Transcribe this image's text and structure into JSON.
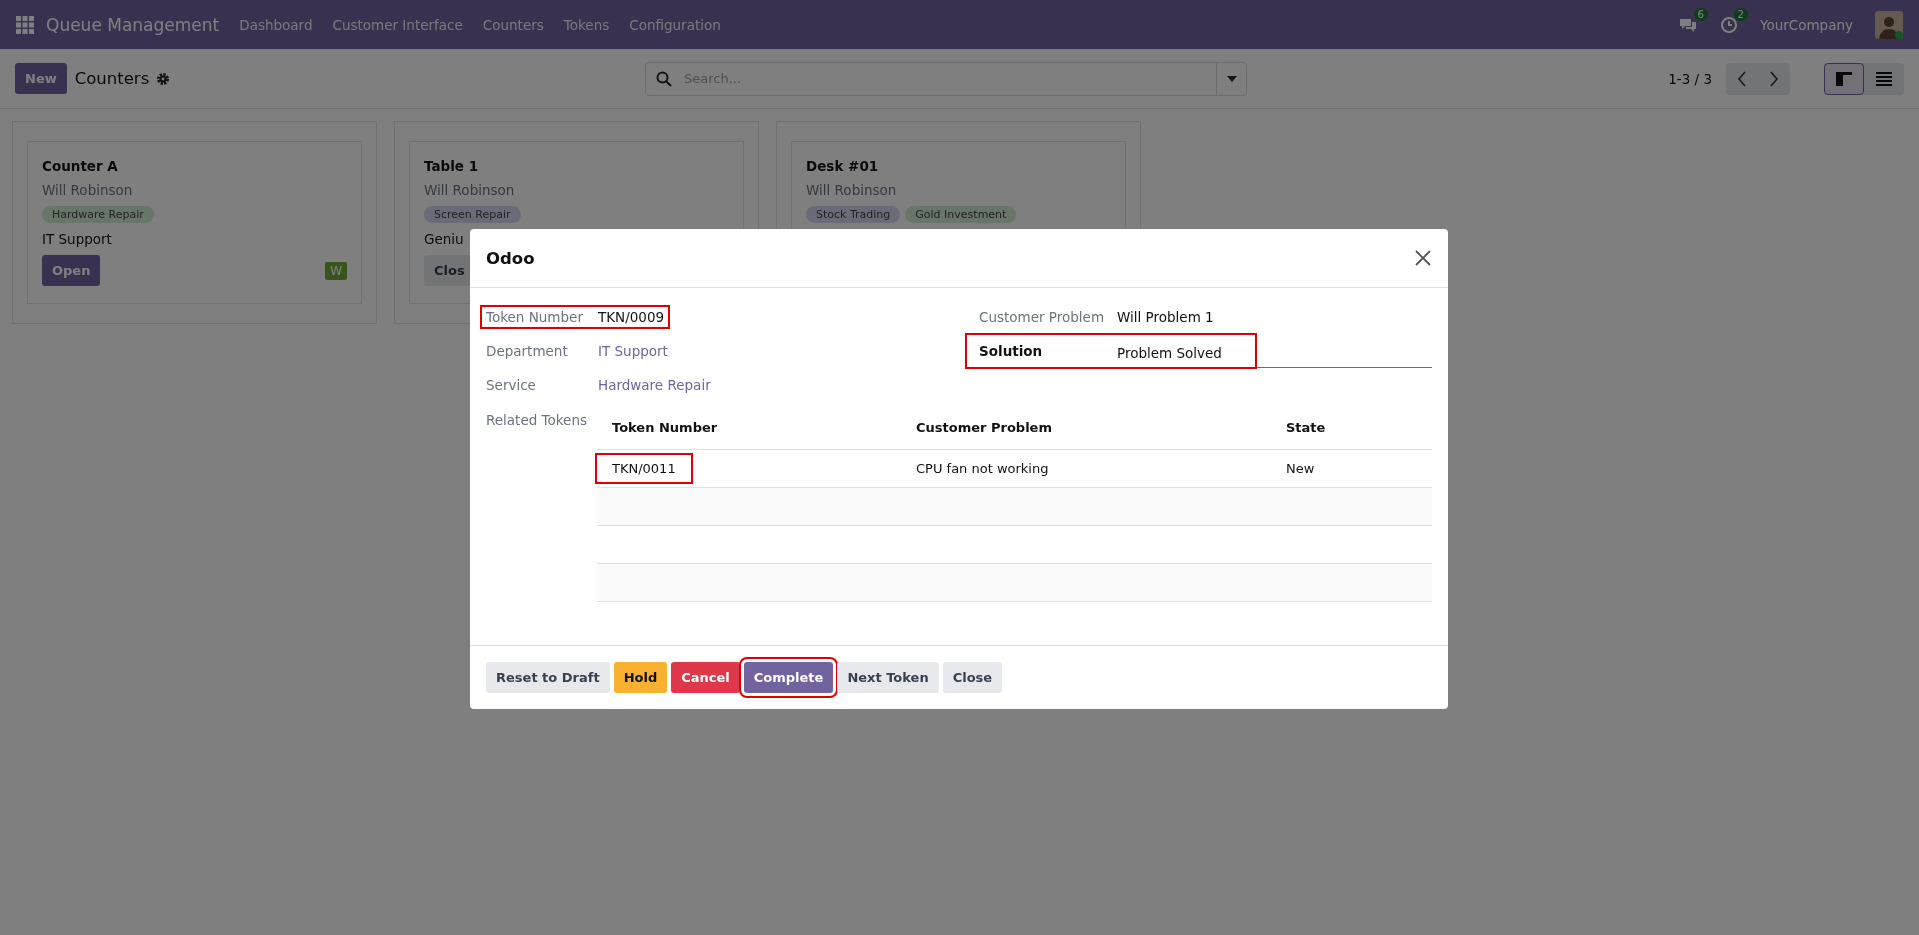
{
  "navbar": {
    "app_name": "Queue Management",
    "menu": [
      "Dashboard",
      "Customer Interface",
      "Counters",
      "Tokens",
      "Configuration"
    ],
    "messages_count": "6",
    "activities_count": "2",
    "company": "YourCompany"
  },
  "control_panel": {
    "new_button": "New",
    "title": "Counters",
    "search": {
      "placeholder": "Search..."
    },
    "pager": "1-3 / 3",
    "views": [
      {
        "kind": "kanban",
        "selected": true
      },
      {
        "kind": "list",
        "selected": false
      }
    ]
  },
  "cards": [
    {
      "name": "Counter A",
      "user": "Will Robinson",
      "tags": [
        {
          "label": "Hardware Repair",
          "color": "#687669"
        }
      ],
      "department": "IT Support",
      "button": {
        "label": "Open",
        "kind": "primary"
      },
      "badge": "W"
    },
    {
      "name": "Table 1",
      "user": "Will Robinson",
      "tags": [
        {
          "label": "Screen Repair",
          "color": "#696b79"
        }
      ],
      "department": "Geniu",
      "button": {
        "label": "Clos",
        "kind": "secondary"
      }
    },
    {
      "name": "Desk #01",
      "user": "Will Robinson",
      "tags": [
        {
          "label": "Stock Trading",
          "color": "#696b79"
        },
        {
          "label": "Gold Investment",
          "color": "#687669"
        }
      ]
    }
  ],
  "dialog": {
    "title": "Odoo",
    "left_fields": [
      {
        "label": "Token Number",
        "value": "TKN/0009",
        "kind": "text",
        "highlighted": true
      },
      {
        "label": "Department",
        "value": "IT Support",
        "kind": "link",
        "highlighted": false
      },
      {
        "label": "Service",
        "value": "Hardware Repair",
        "kind": "link",
        "highlighted": false
      }
    ],
    "right_fields": [
      {
        "label": "Customer Problem",
        "value": "Will Problem 1",
        "kind": "text",
        "highlighted": false
      },
      {
        "label": "Solution",
        "value": "Problem Solved",
        "kind": "input",
        "highlighted": true
      }
    ],
    "related_tokens": {
      "label": "Related Tokens",
      "columns": [
        "Token Number",
        "Customer Problem",
        "State"
      ],
      "rows": [
        {
          "cells": [
            "TKN/0011",
            "CPU fan not working",
            "New"
          ],
          "highlighted": true
        }
      ]
    },
    "buttons": [
      {
        "label": "Reset to Draft",
        "kind": "secondary",
        "highlighted": false
      },
      {
        "label": "Hold",
        "kind": "warning",
        "highlighted": false
      },
      {
        "label": "Cancel",
        "kind": "danger",
        "highlighted": false
      },
      {
        "label": "Complete",
        "kind": "primary",
        "highlighted": true
      },
      {
        "label": "Next Token",
        "kind": "secondary",
        "highlighted": false
      },
      {
        "label": "Close",
        "kind": "secondary",
        "highlighted": false
      }
    ]
  }
}
